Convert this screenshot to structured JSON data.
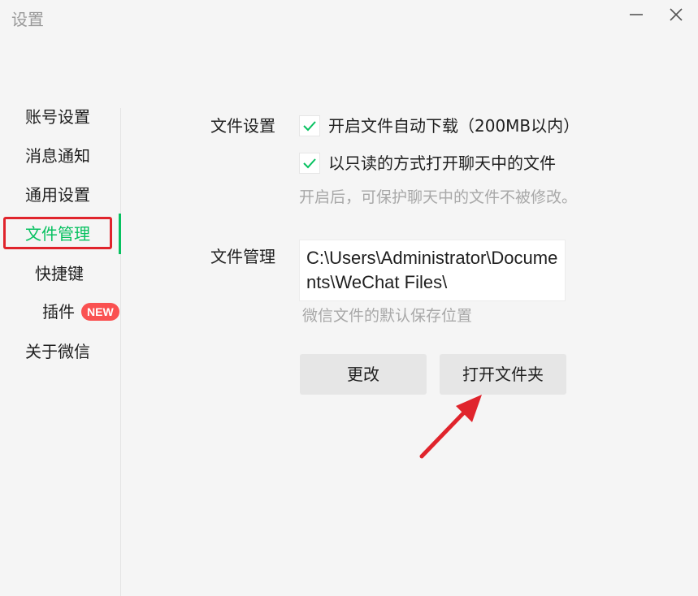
{
  "window": {
    "title": "设置"
  },
  "sidebar": {
    "items": [
      {
        "label": "账号设置"
      },
      {
        "label": "消息通知"
      },
      {
        "label": "通用设置"
      },
      {
        "label": "文件管理",
        "active": true
      },
      {
        "label": "快捷键"
      },
      {
        "label": "插件",
        "badge": "NEW"
      },
      {
        "label": "关于微信"
      }
    ]
  },
  "file_settings": {
    "section_label": "文件设置",
    "auto_download": {
      "label": "开启文件自动下载（200MB以内）",
      "checked": true
    },
    "read_only": {
      "label": "以只读的方式打开聊天中的文件",
      "checked": true
    },
    "hint": "开启后，可保护聊天中的文件不被修改。"
  },
  "file_management": {
    "section_label": "文件管理",
    "path": "C:\\Users\\Administrator\\Documents\\WeChat Files\\",
    "hint": "微信文件的默认保存位置",
    "change_button": "更改",
    "open_folder_button": "打开文件夹"
  },
  "colors": {
    "accent": "#07c160",
    "annotation_red": "#e0242c",
    "badge": "#fa5151"
  },
  "icons": {
    "minimize": "minimize-icon",
    "close": "close-icon",
    "checkmark": "checkmark-icon",
    "annotation_arrow": "arrow-icon"
  }
}
